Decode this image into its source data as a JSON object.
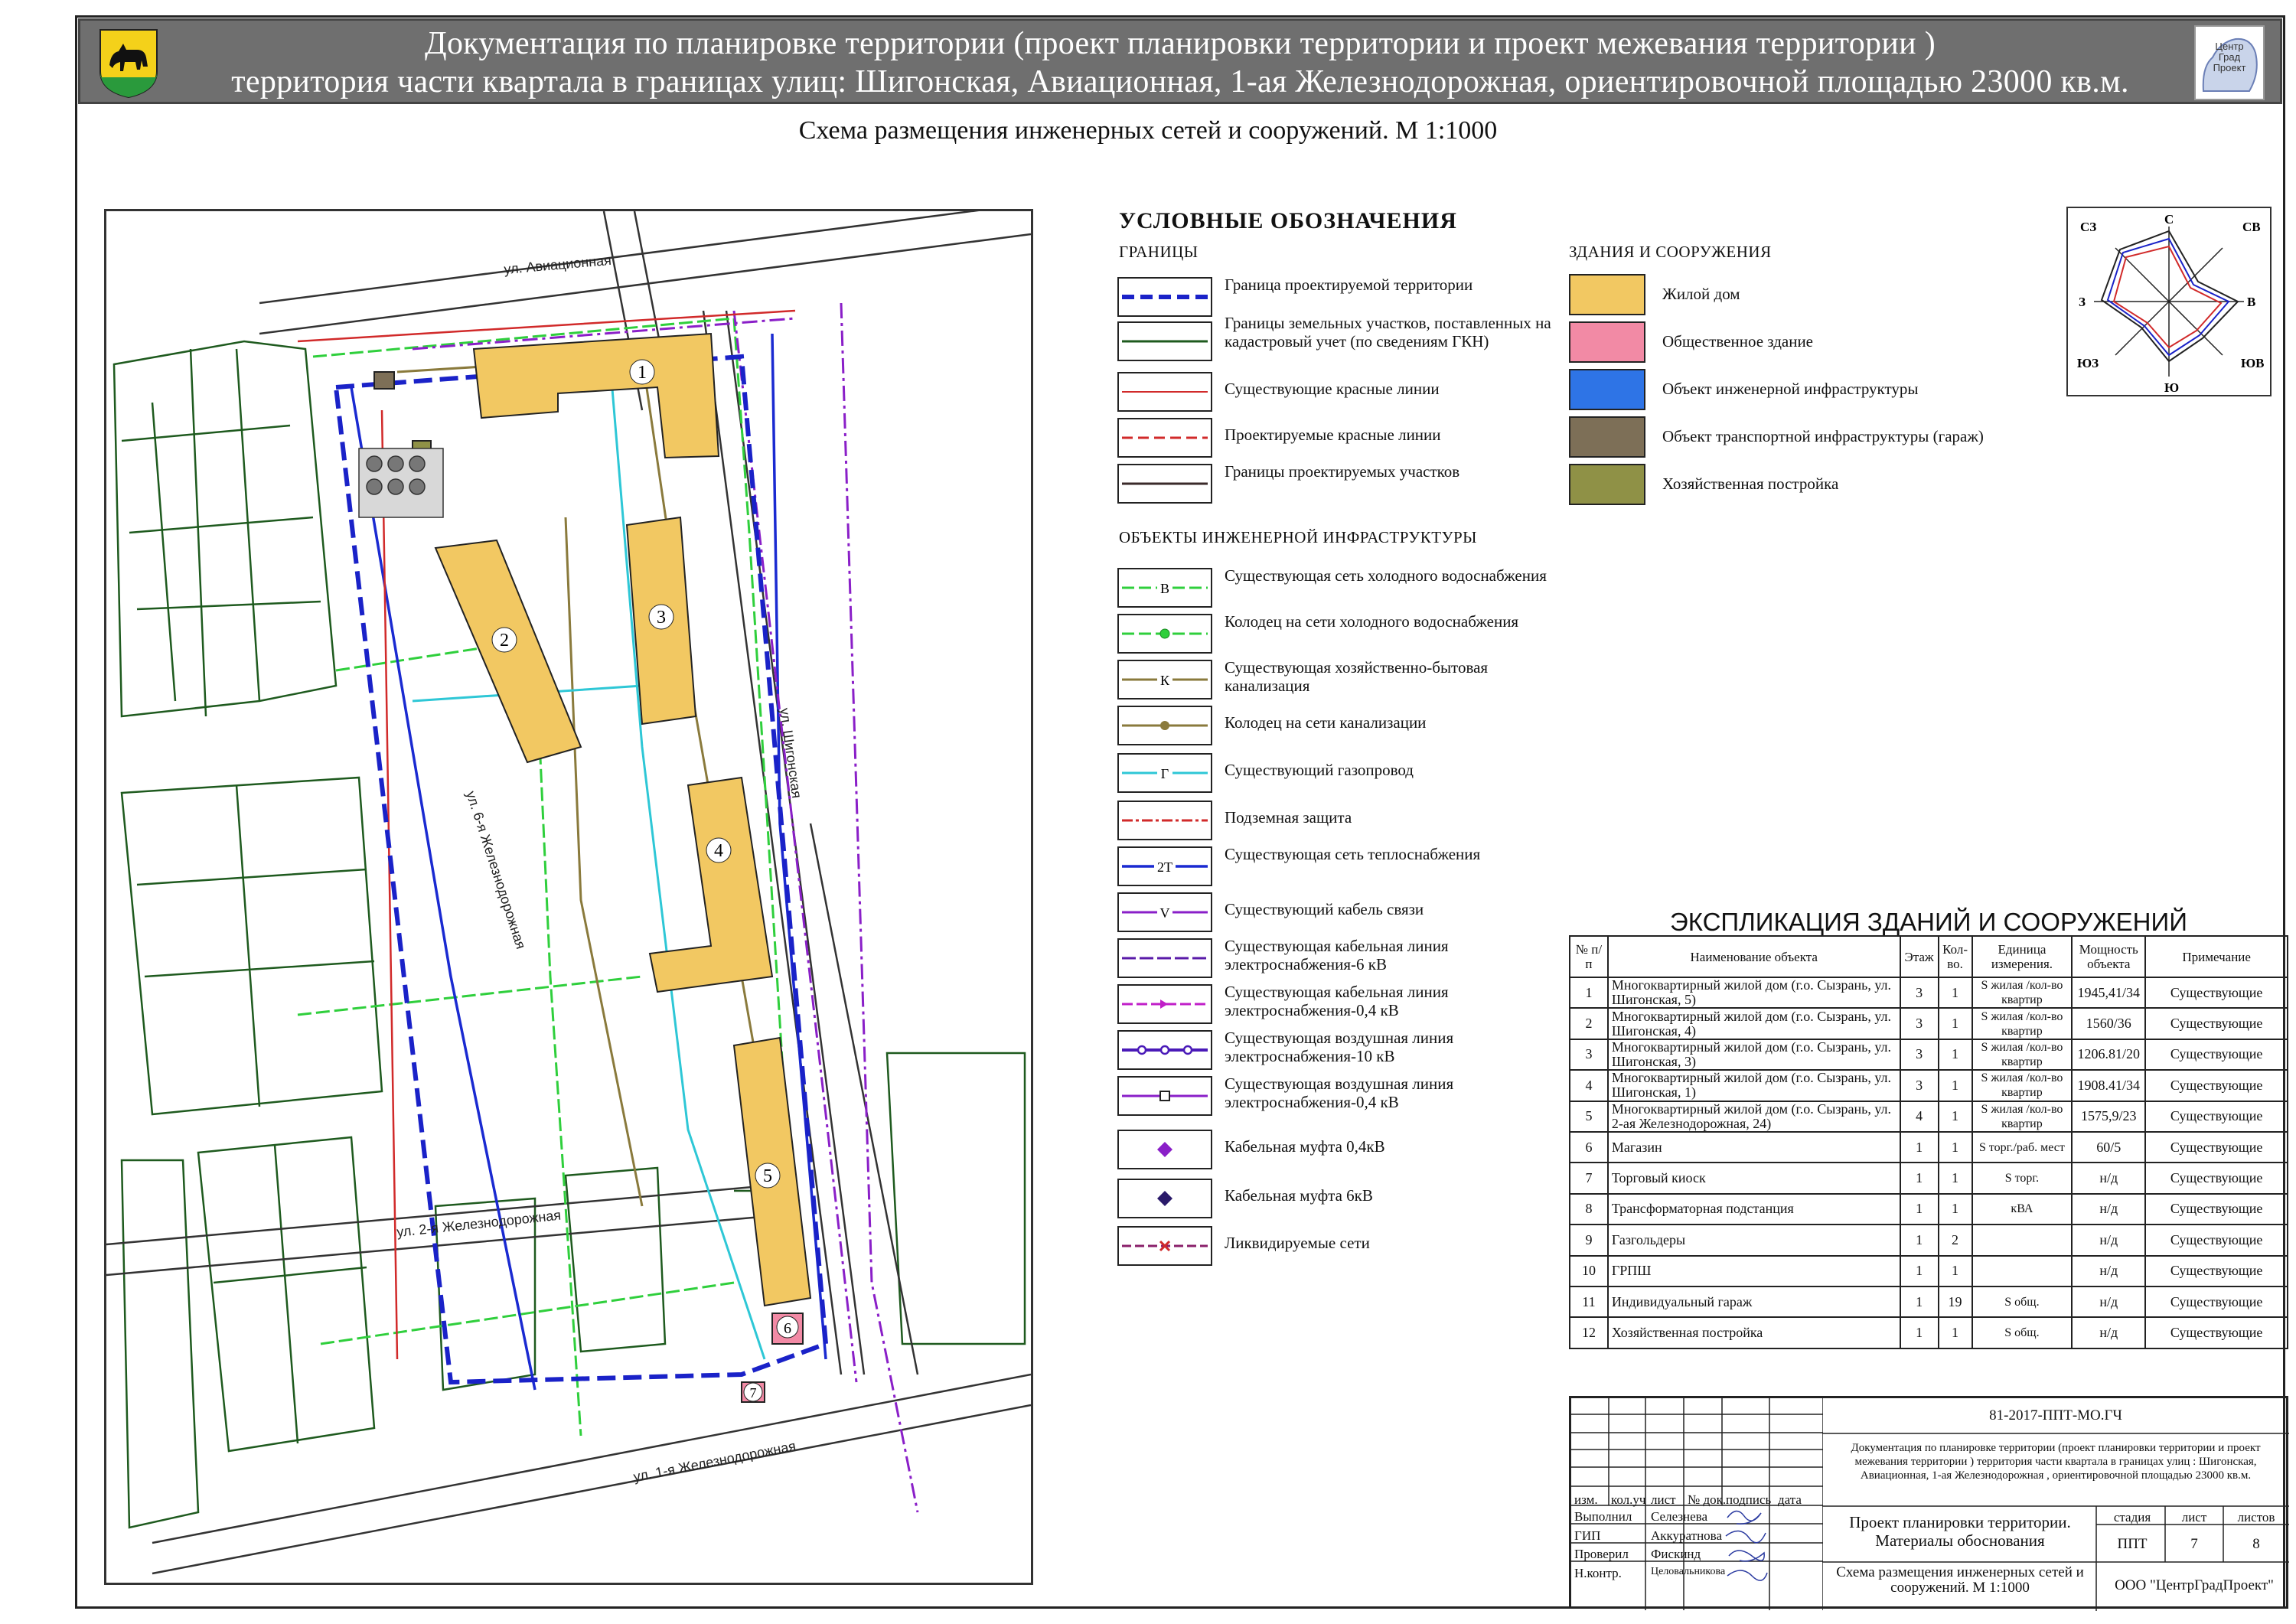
{
  "header": {
    "line1": "Документация по планировке территории (проект планировки территории и проект межевания территории )",
    "line2": "территория части квартала в границах улиц: Шигонская, Авиационная, 1-ая Железнодорожная, ориентировочной площадью 23000 кв.м.",
    "right_logo_text": [
      "Центр",
      "Град",
      "Проект"
    ]
  },
  "scheme_title": "Схема размещения инженерных сетей и сооружений. М 1:1000",
  "map": {
    "street_labels": [
      "ул. Авиационная",
      "ул. 6-я Железнодорожная",
      "ул. Шигонская",
      "ул. 2-я Железнодорожная",
      "ул. 1-я Железнодорожная"
    ],
    "building_numbers": [
      "1",
      "2",
      "3",
      "4",
      "5",
      "6",
      "7"
    ]
  },
  "legend": {
    "title": "УСЛОВНЫЕ ОБОЗНАЧЕНИЯ",
    "boundaries_header": "ГРАНИЦЫ",
    "boundaries": [
      "Граница проектируемой территории",
      "Границы земельных участков, поставленных на кадастровый учет (по сведениям ГКН)",
      "Существующие красные линии",
      "Проектируемые красные линии",
      "Границы проектируемых участков"
    ],
    "infra_header": "ОБЪЕКТЫ ИНЖЕНЕРНОЙ ИНФРАСТРУКТУРЫ",
    "infra": [
      {
        "label": "Существующая сеть холодного водоснабжения",
        "code": "В"
      },
      {
        "label": "Колодец на сети холодного водоснабжения",
        "code": ""
      },
      {
        "label": "Существующая хозяйственно-бытовая канализация",
        "code": "К"
      },
      {
        "label": "Колодец на сети канализации",
        "code": ""
      },
      {
        "label": "Существующий газопровод",
        "code": "Г"
      },
      {
        "label": "Подземная защита",
        "code": ""
      },
      {
        "label": "Существующая сеть теплоснабжения",
        "code": "2Т"
      },
      {
        "label": "Существующий кабель связи",
        "code": "V"
      },
      {
        "label": "Существующая кабельная линия электроснабжения-6 кВ",
        "code": ""
      },
      {
        "label": "Существующая кабельная линия электроснабжения-0,4 кВ",
        "code": ""
      },
      {
        "label": "Существующая воздушная линия электроснабжения-10 кВ",
        "code": ""
      },
      {
        "label": "Существующая воздушная линия электроснабжения-0,4 кВ",
        "code": ""
      },
      {
        "label": "Кабельная муфта 0,4кВ",
        "code": ""
      },
      {
        "label": "Кабельная муфта 6кВ",
        "code": ""
      },
      {
        "label": "Ликвидируемые сети",
        "code": ""
      }
    ],
    "buildings_header": "ЗДАНИЯ  И СООРУЖЕНИЯ",
    "buildings": [
      {
        "label": "Жилой дом",
        "color": "#f2c862"
      },
      {
        "label": "Общественное здание",
        "color": "#f28aa5"
      },
      {
        "label": "Объект инженерной инфраструктуры",
        "color": "#2e74e6"
      },
      {
        "label": "Объект транспортной инфраструктуры (гараж)",
        "color": "#7d6f57"
      },
      {
        "label": "Хозяйственная постройка",
        "color": "#8f9146"
      }
    ]
  },
  "compass": {
    "n": "С",
    "ne": "СВ",
    "e": "В",
    "se": "ЮВ",
    "s": "Ю",
    "sw": "ЮЗ",
    "w": "З",
    "nw": "СЗ"
  },
  "explication": {
    "title": "ЭКСПЛИКАЦИЯ ЗДАНИЙ И СООРУЖЕНИЙ",
    "headers": [
      "№ п/п",
      "Наименование объекта",
      "Этаж",
      "Кол-во.",
      "Единица измерения.",
      "Мощность объекта",
      "Примечание"
    ],
    "rows": [
      [
        "1",
        "Многоквартирный жилой дом (г.о. Сызрань, ул. Шигонская, 5)",
        "3",
        "1",
        "S жилая /кол-во квартир",
        "1945,41/34",
        "Существующие"
      ],
      [
        "2",
        "Многоквартирный жилой дом (г.о. Сызрань, ул. Шигонская, 4)",
        "3",
        "1",
        "S жилая /кол-во квартир",
        "1560/36",
        "Существующие"
      ],
      [
        "3",
        "Многоквартирный жилой дом  (г.о. Сызрань, ул. Шигонская, 3)",
        "3",
        "1",
        "S жилая /кол-во квартир",
        "1206.81/20",
        "Существующие"
      ],
      [
        "4",
        "Многоквартирный жилой дом (г.о. Сызрань, ул. Шигонская, 1)",
        "3",
        "1",
        "S жилая /кол-во квартир",
        "1908.41/34",
        "Существующие"
      ],
      [
        "5",
        "Многоквартирный жилой дом (г.о. Сызрань, ул. 2-ая Железнодорожная, 24)",
        "4",
        "1",
        "S жилая /кол-во квартир",
        "1575,9/23",
        "Существующие"
      ],
      [
        "6",
        "Магазин",
        "1",
        "1",
        "S торг./раб. мест",
        "60/5",
        "Существующие"
      ],
      [
        "7",
        "Торговый киоск",
        "1",
        "1",
        "S торг.",
        "н/д",
        "Существующие"
      ],
      [
        "8",
        "Трансформаторная подстанция",
        "1",
        "1",
        "кВА",
        "н/д",
        "Существующие"
      ],
      [
        "9",
        "Газгольдеры",
        "1",
        "2",
        "",
        "н/д",
        "Существующие"
      ],
      [
        "10",
        "ГРПШ",
        "1",
        "1",
        "",
        "н/д",
        "Существующие"
      ],
      [
        "11",
        "Индивидуальный гараж",
        "1",
        "19",
        "S общ.",
        "н/д",
        "Существующие"
      ],
      [
        "12",
        "Хозяйственная постройка",
        "1",
        "1",
        "S общ.",
        "н/д",
        "Существующие"
      ]
    ]
  },
  "stamp": {
    "code": "81-2017-ППТ-МО.ГЧ",
    "description": "Документация по планировке территории  (проект планировки территории и проект межевания территории ) территория части квартала в границах улиц : Шигонская, Авиационная, 1-ая Железнодорожная , ориентировочной площадью 23000 кв.м.",
    "col_headers": [
      "изм.",
      "кол.уч",
      "лист",
      "№ док.",
      "подпись",
      "дата"
    ],
    "roles": [
      {
        "role": "Выполнил",
        "name": "Селезнева"
      },
      {
        "role": "ГИП",
        "name": "Аккуратнова"
      },
      {
        "role": "Проверил",
        "name": "Фискинд"
      },
      {
        "role": "Н.контр.",
        "name": "Целовальникова"
      }
    ],
    "project_name": "Проект планировки территории. Материалы обоснования",
    "stage_label": "стадия",
    "sheet_label": "лист",
    "sheets_label": "листов",
    "stage": "ППТ",
    "sheet": "7",
    "sheets": "8",
    "drawing_name": "Схема размещения инженерных сетей и сооружений. М 1:1000",
    "company": "ООО \"ЦентрГрадПроект\""
  }
}
